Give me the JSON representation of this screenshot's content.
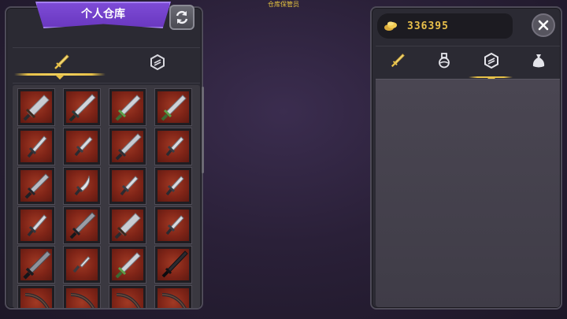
{
  "top_label": "仓库保管员",
  "left_panel": {
    "title": "个人仓库",
    "refresh_icon": "refresh-icon",
    "tabs": [
      {
        "icon": "sword-tab-icon",
        "active": true
      },
      {
        "icon": "armor-tab-icon",
        "active": false
      }
    ],
    "slots": [
      {
        "icon": "broadsword-icon"
      },
      {
        "icon": "greatsword-icon"
      },
      {
        "icon": "green-hilt-sword-icon"
      },
      {
        "icon": "green-hilt-sword-icon"
      },
      {
        "icon": "short-blade-icon"
      },
      {
        "icon": "dagger-icon"
      },
      {
        "icon": "longsword-icon"
      },
      {
        "icon": "dagger-icon"
      },
      {
        "icon": "serrated-sword-icon"
      },
      {
        "icon": "curved-dagger-icon"
      },
      {
        "icon": "dagger-icon"
      },
      {
        "icon": "dagger-icon"
      },
      {
        "icon": "short-blade-icon"
      },
      {
        "icon": "dark-sword-icon"
      },
      {
        "icon": "broadsword-icon"
      },
      {
        "icon": "dagger-icon"
      },
      {
        "icon": "dark-greatsword-icon"
      },
      {
        "icon": "knife-icon"
      },
      {
        "icon": "green-hilt-sword-icon"
      },
      {
        "icon": "black-blade-icon"
      },
      {
        "icon": "bow-icon"
      },
      {
        "icon": "bow-icon"
      },
      {
        "icon": "bow-icon"
      },
      {
        "icon": "bow-icon"
      }
    ]
  },
  "right_panel": {
    "gold_icon": "gold-coin-icon",
    "gold_amount": "336395",
    "close_icon": "close-icon",
    "tabs": [
      {
        "icon": "sword-tab-icon",
        "active": false
      },
      {
        "icon": "potion-tab-icon",
        "active": false
      },
      {
        "icon": "armor-tab-icon",
        "active": true
      },
      {
        "icon": "bag-tab-icon",
        "active": false
      }
    ]
  },
  "colors": {
    "accent_gold": "#e7c148",
    "ribbon_purple": "#7d4bd6",
    "slot_red": "#a13a24"
  }
}
